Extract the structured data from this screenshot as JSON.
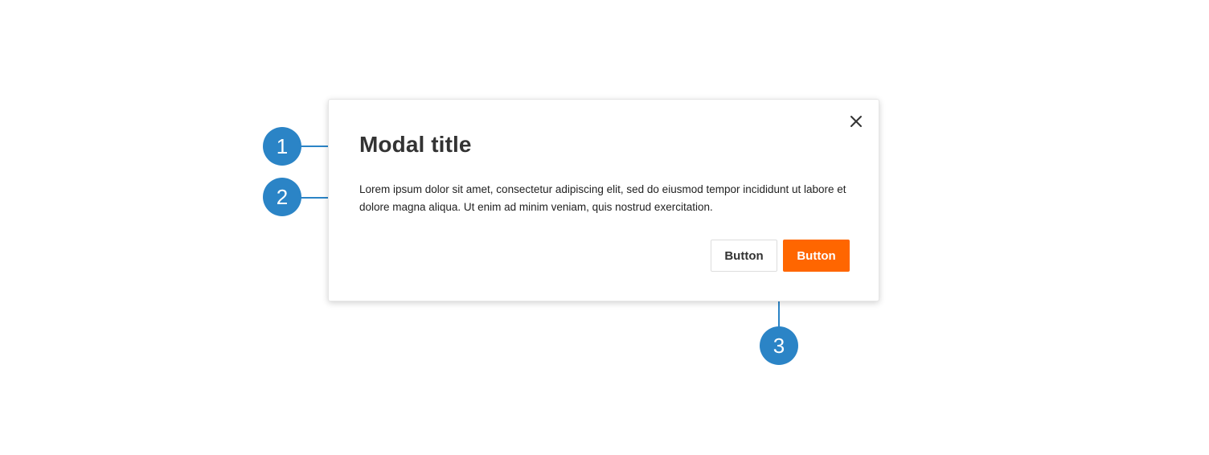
{
  "modal": {
    "title": "Modal title",
    "body": "Lorem ipsum dolor sit amet, consectetur adipiscing elit, sed do eiusmod tempor incididunt ut labore et dolore magna aliqua. Ut enim ad minim veniam, quis nostrud exercitation.",
    "close_icon": "close-icon",
    "secondary_button_label": "Button",
    "primary_button_label": "Button"
  },
  "callouts": [
    {
      "label": "1"
    },
    {
      "label": "2"
    },
    {
      "label": "3"
    }
  ],
  "colors": {
    "accent": "#ff6600",
    "callout": "#2b84c6",
    "title_text": "#333333"
  }
}
